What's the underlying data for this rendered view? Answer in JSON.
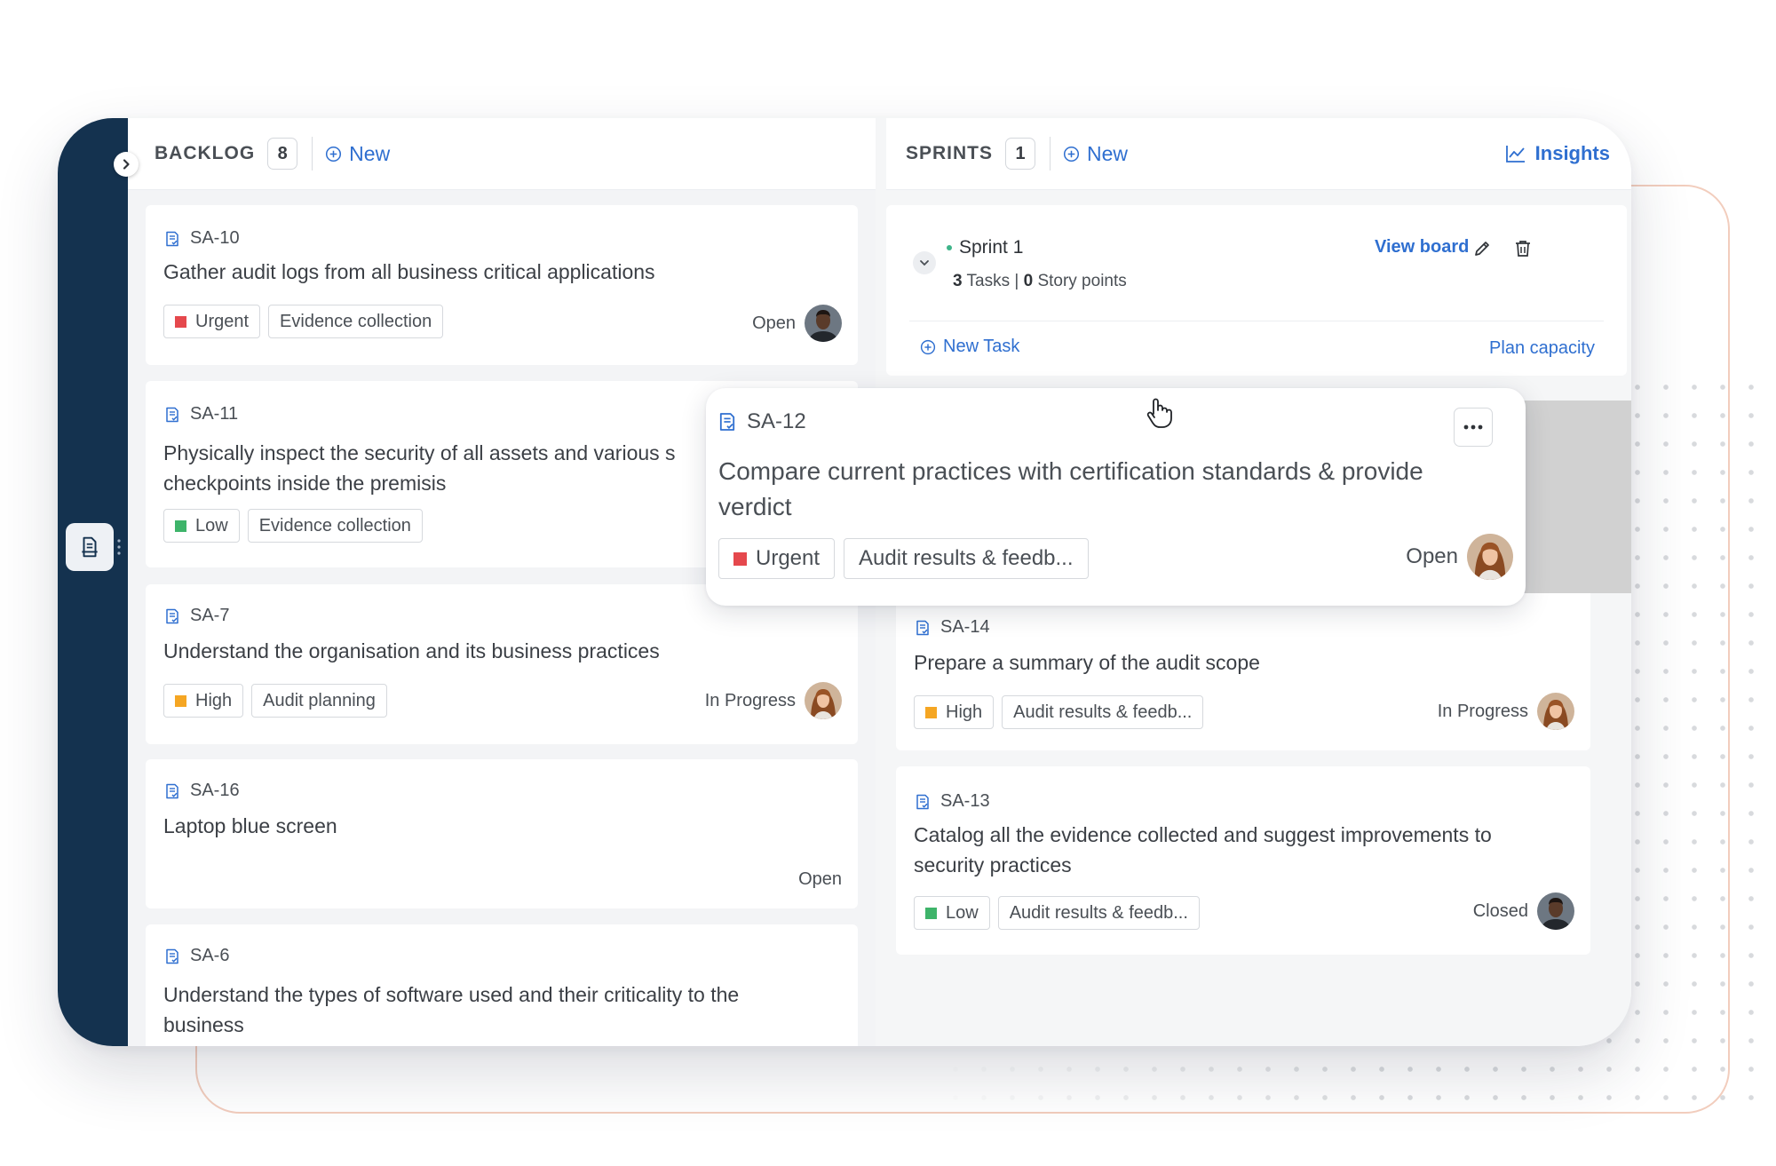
{
  "colors": {
    "accent": "#2f6fd0",
    "rail": "#14324f",
    "urgent": "#e5484d",
    "high": "#f5a623",
    "low": "#3eb46a",
    "sprint_dot": "#3eb489"
  },
  "backlog": {
    "title": "BACKLOG",
    "count": "8",
    "new_label": "New",
    "search_icon": "search-icon",
    "cards": [
      {
        "id": "SA-10",
        "title": "Gather audit logs from all business critical applications",
        "priority": "Urgent",
        "category": "Evidence collection",
        "status": "Open",
        "avatar": "man"
      },
      {
        "id": "SA-11",
        "title": "Physically inspect the security of all assets and various s checkpoints inside the premisis",
        "priority": "Low",
        "category": "Evidence collection",
        "status": "",
        "avatar": ""
      },
      {
        "id": "SA-7",
        "title": "Understand the organisation and its business practices",
        "priority": "High",
        "category": "Audit planning",
        "status": "In Progress",
        "avatar": "woman"
      },
      {
        "id": "SA-16",
        "title": "Laptop blue screen",
        "priority": "",
        "category": "",
        "status": "Open",
        "avatar": ""
      },
      {
        "id": "SA-6",
        "title": "Understand the types of software used and their criticality to the business",
        "priority": "",
        "category": "",
        "status": "",
        "avatar": ""
      }
    ]
  },
  "sprints": {
    "title": "SPRINTS",
    "count": "1",
    "new_label": "New",
    "insights_label": "Insights",
    "sprint": {
      "name": "Sprint 1",
      "tasks_count": "3",
      "tasks_label": "Tasks |",
      "points_count": "0",
      "points_label": "Story points",
      "view_board_label": "View board",
      "new_task_label": "New Task",
      "plan_capacity_label": "Plan capacity"
    },
    "cards": [
      {
        "id": "SA-14",
        "title": "Prepare a summary of the audit scope",
        "priority": "High",
        "category": "Audit results & feedb...",
        "status": "In Progress",
        "avatar": "woman"
      },
      {
        "id": "SA-13",
        "title": "Catalog all the evidence collected and suggest improvements to security practices",
        "priority": "Low",
        "category": "Audit results & feedb...",
        "status": "Closed",
        "avatar": "man"
      }
    ]
  },
  "dragging_card": {
    "id": "SA-12",
    "title": "Compare current practices with certification standards & provide verdict",
    "priority": "Urgent",
    "category": "Audit results & feedb...",
    "status": "Open",
    "avatar": "woman"
  }
}
